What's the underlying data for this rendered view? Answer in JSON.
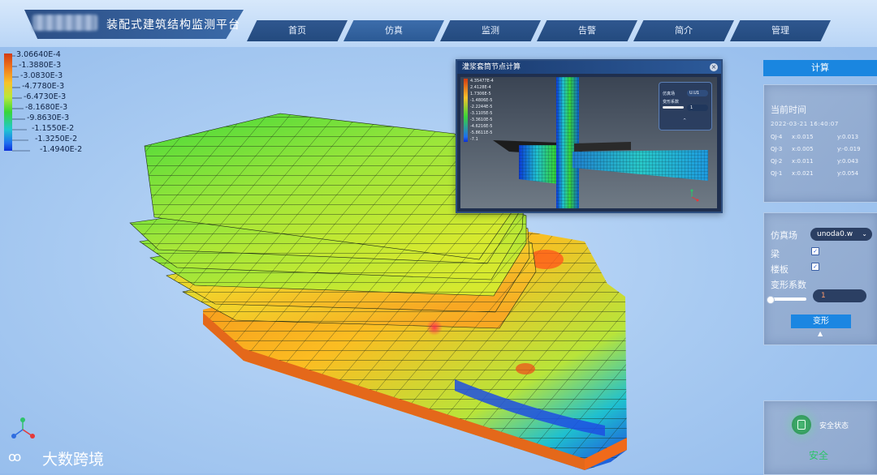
{
  "header": {
    "title": "装配式建筑结构监测平台",
    "nav": [
      {
        "label": "首页",
        "active": false
      },
      {
        "label": "仿真",
        "active": true
      },
      {
        "label": "监测",
        "active": false
      },
      {
        "label": "告警",
        "active": false
      },
      {
        "label": "简介",
        "active": false
      },
      {
        "label": "管理",
        "active": false
      }
    ]
  },
  "legend": {
    "labels": [
      "3.06640E-4",
      "-1.3880E-3",
      "-3.0830E-3",
      "-4.7780E-3",
      "-6.4730E-3",
      "-8.1680E-3",
      "-9.8630E-3",
      "-1.1550E-2",
      "-1.3250E-2",
      "-1.4940E-2"
    ]
  },
  "popup": {
    "title": "灌浆套筒节点计算",
    "legend_labels": [
      "4.35477E-4",
      "2.4128E-4",
      "1.7306E-5",
      "-1.4806E-5",
      "-2.2244E-5",
      "-3.1105E-5",
      "-3.3610E-5",
      "-4.6216E-5",
      "-5.8611E-5",
      "-7.1"
    ],
    "panel": {
      "field_label": "仿真场",
      "field_value": "U.U1",
      "deform_label": "变形系数",
      "deform_value": "1"
    }
  },
  "right": {
    "calc_button": "计算",
    "time_title": "当前时间",
    "time_value": "2022-03-21 16:40:07",
    "readings": [
      {
        "id": "QJ-4",
        "x": "x:0.015",
        "y": "y:0.013"
      },
      {
        "id": "QJ-3",
        "x": "x:0.005",
        "y": "y:-0.019"
      },
      {
        "id": "QJ-2",
        "x": "x:0.011",
        "y": "y:0.043"
      },
      {
        "id": "QJ-1",
        "x": "x:0.021",
        "y": "y:0.054"
      }
    ],
    "controls": {
      "field_label": "仿真场",
      "field_value": "unoda0.w",
      "beam_label": "梁",
      "slab_label": "楼板",
      "deform_label": "变形系数",
      "deform_value": "1",
      "deform_button": "变形"
    },
    "safety": {
      "label": "安全状态",
      "value": "安全"
    }
  },
  "watermark": "大数跨境"
}
